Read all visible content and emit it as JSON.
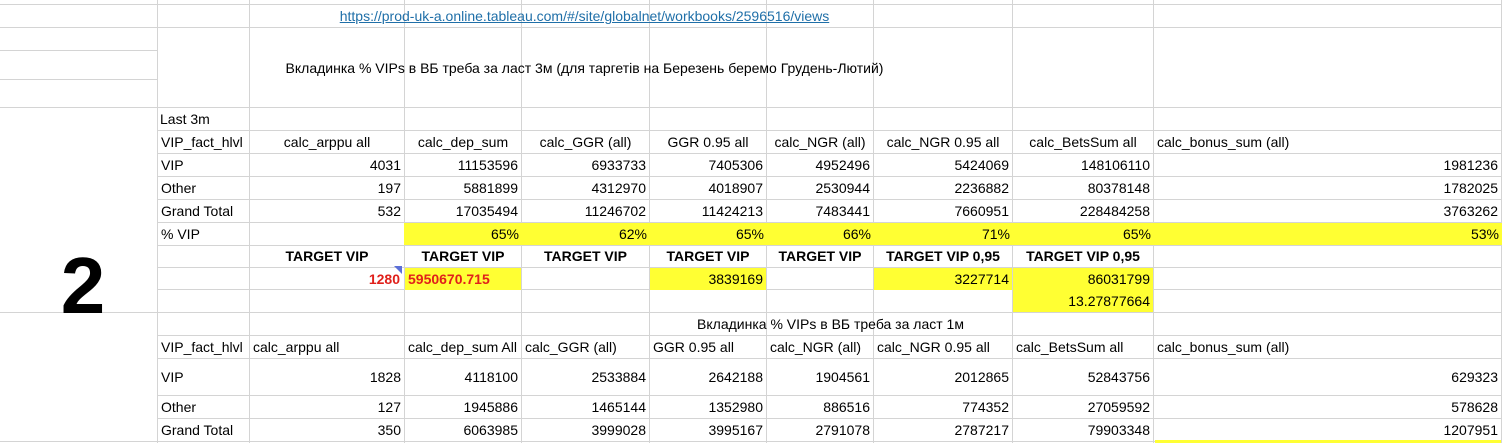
{
  "link_url": "https://prod-uk-a.online.tableau.com/#/site/globalnet/workbooks/2596516/views",
  "section1_title": "Вкладинка  % VIPs в ВБ треба за ласт 3м (для таргетів на Березень беремо Грудень-Лютий)",
  "big_number": "2",
  "last_label": "Last 3m",
  "headers1": [
    "VIP_fact_hlvl",
    "calc_arppu all",
    "calc_dep_sum",
    "calc_GGR (all)",
    "GGR 0.95 all",
    "calc_NGR (all)",
    "calc_NGR 0.95 all",
    "calc_BetsSum all",
    "calc_bonus_sum (all)"
  ],
  "rows1": [
    {
      "label": "VIP",
      "values": [
        "4031",
        "11153596",
        "6933733",
        "7405306",
        "4952496",
        "5424069",
        "148106110",
        "1981236"
      ]
    },
    {
      "label": "Other",
      "values": [
        "197",
        "5881899",
        "4312970",
        "4018907",
        "2530944",
        "2236882",
        "80378148",
        "1782025"
      ]
    },
    {
      "label": "Grand Total",
      "values": [
        "532",
        "17035494",
        "11246702",
        "11424213",
        "7483441",
        "7660951",
        "228484258",
        "3763262"
      ]
    }
  ],
  "pct_row": {
    "label": "% VIP",
    "values": [
      "",
      "65%",
      "62%",
      "65%",
      "66%",
      "71%",
      "65%",
      "53%"
    ]
  },
  "target_labels": [
    "TARGET VIP",
    "TARGET VIP",
    "TARGET VIP",
    "TARGET VIP",
    "TARGET VIP",
    "TARGET VIP 0,95",
    "TARGET VIP 0,95"
  ],
  "target_values": [
    "1280",
    "5950670.715",
    "",
    "3839169",
    "",
    "3227714",
    "86031799"
  ],
  "extra_value": "13.27877664",
  "section2_title": "Вкладинка  % VIPs в ВБ треба за ласт 1м",
  "headers2": [
    "VIP_fact_hlvl",
    "calc_arppu all",
    "calc_dep_sum All",
    "calc_GGR (all)",
    "GGR 0.95 all",
    "calc_NGR (all)",
    "calc_NGR 0.95 all",
    "calc_BetsSum all",
    "calc_bonus_sum (all)"
  ],
  "rows2": [
    {
      "label": "VIP",
      "values": [
        "1828",
        "4118100",
        "2533884",
        "2642188",
        "1904561",
        "2012865",
        "52843756",
        "629323"
      ]
    },
    {
      "label": "Other",
      "values": [
        "127",
        "1945886",
        "1465144",
        "1352980",
        "886516",
        "774352",
        "27059592",
        "578628"
      ]
    },
    {
      "label": "Grand Total",
      "values": [
        "350",
        "6063985",
        "3999028",
        "3995167",
        "2791078",
        "2787217",
        "79903348",
        "1207951"
      ]
    }
  ],
  "colors": {
    "highlight": "#ffff33",
    "red_text": "#e0201b",
    "link": "#1f6fa8",
    "grid": "#d4d4d4"
  }
}
